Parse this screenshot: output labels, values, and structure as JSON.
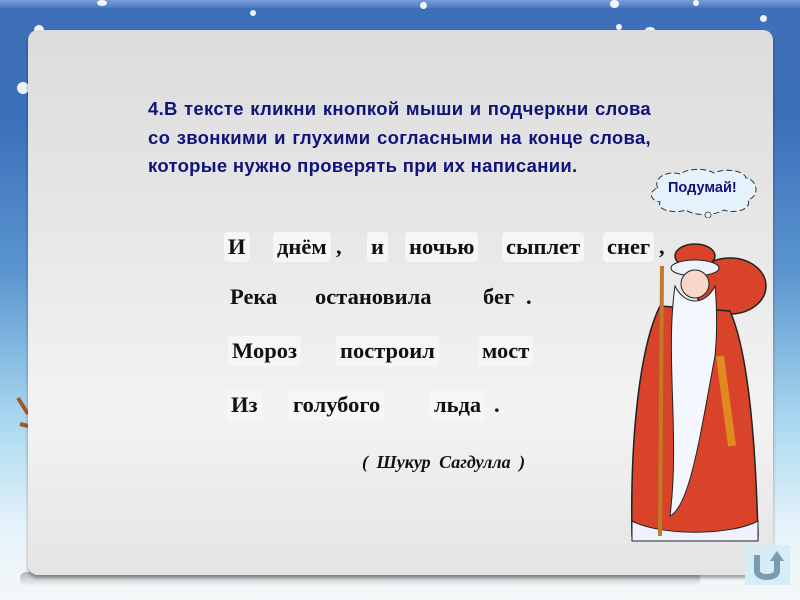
{
  "slide": {
    "task_text": "4.В тексте кликни кнопкой мыши и подчеркни слова со звонкими и глухими согласными на конце слова, которые нужно проверять при их написании.",
    "poem_lines": [
      {
        "words": [
          "И",
          "днём",
          "и",
          "ночью",
          "сыплет",
          "снег"
        ],
        "punctuation": [
          ",",
          ","
        ]
      },
      {
        "words": [
          "Река",
          "остановила",
          "бег"
        ],
        "punctuation": [
          "."
        ]
      },
      {
        "words": [
          "Мороз",
          "построил",
          "мост"
        ],
        "punctuation": []
      },
      {
        "words": [
          "Из",
          "голубого",
          "льда"
        ],
        "punctuation": [
          "."
        ]
      }
    ],
    "author": "( Шукур  Сагдулла )",
    "thought_bubble": "Подумай!",
    "back_button_icon": "u-turn-arrow-icon"
  },
  "colors": {
    "task_text": "#10137a",
    "poem_text": "#111111",
    "background_top": "#3e6fb8",
    "card": "#e8e8e8"
  }
}
